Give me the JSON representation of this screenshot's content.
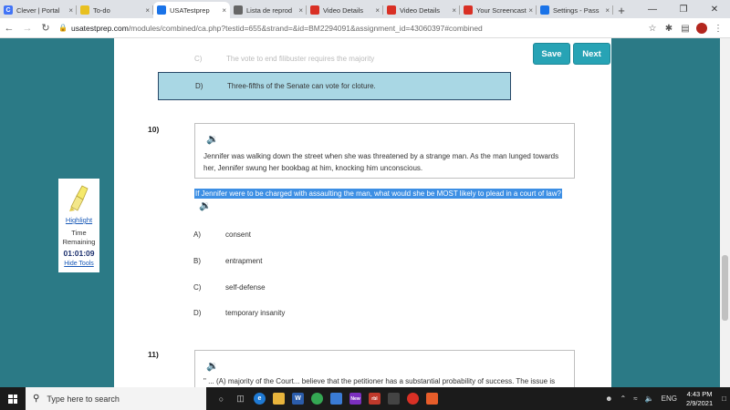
{
  "browser": {
    "tabs": [
      {
        "label": "Clever | Portal",
        "fav_color": "#4274f6",
        "fav_glyph": "C",
        "active": false
      },
      {
        "label": "To-do",
        "fav_color": "#e8c020",
        "fav_glyph": "",
        "active": false
      },
      {
        "label": "USATestprep",
        "fav_color": "#1a73e8",
        "fav_glyph": "",
        "active": true
      },
      {
        "label": "Lista de reprod",
        "fav_color": "#666666",
        "fav_glyph": "",
        "active": false
      },
      {
        "label": "Video Details",
        "fav_color": "#d93025",
        "fav_glyph": "",
        "active": false
      },
      {
        "label": "Video Details",
        "fav_color": "#d93025",
        "fav_glyph": "",
        "active": false
      },
      {
        "label": "Your Screencast",
        "fav_color": "#d93025",
        "fav_glyph": "",
        "active": false
      },
      {
        "label": "Settings - Pass",
        "fav_color": "#1a73e8",
        "fav_glyph": "",
        "active": false
      }
    ],
    "new_tab": "+",
    "address_host": "usatestprep.com",
    "address_path": "/modules/combined/ca.php?testid=655&strand=&id=BM2294091&assignment_id=43060397#combined"
  },
  "actions": {
    "save": "Save",
    "next": "Next"
  },
  "prev_question": {
    "ghost_letter": "C)",
    "ghost_text": "The vote to end filibuster requires the majority",
    "selected_letter": "D)",
    "selected_text": "Three-fifths of the Senate can vote for cloture."
  },
  "question10": {
    "number": "10)",
    "passage": "Jennifer was walking down the street when she was threatened by a strange man. As the man lunged towards her, Jennifer swung her bookbag at him, knocking him unconscious.",
    "question": "If Jennifer were to be charged with assaulting the man, what would she be MOST likely to plead in a court of law?",
    "choices": [
      {
        "letter": "A)",
        "text": "consent"
      },
      {
        "letter": "B)",
        "text": "entrapment"
      },
      {
        "letter": "C)",
        "text": "self-defense"
      },
      {
        "letter": "D)",
        "text": "temporary insanity"
      }
    ]
  },
  "question11": {
    "number": "11)",
    "passage": "\" ... (A) majority of the Court... believe that the petitioner has a substantial probability of success. The issue is not,"
  },
  "tools": {
    "highlight": "Highlight",
    "time_label": "Time Remaining",
    "timer": "01:01:09",
    "hide": "Hide Tools"
  },
  "taskbar": {
    "search_placeholder": "Type here to search",
    "lang": "ENG",
    "time": "4:43 PM",
    "date": "2/9/2021"
  }
}
